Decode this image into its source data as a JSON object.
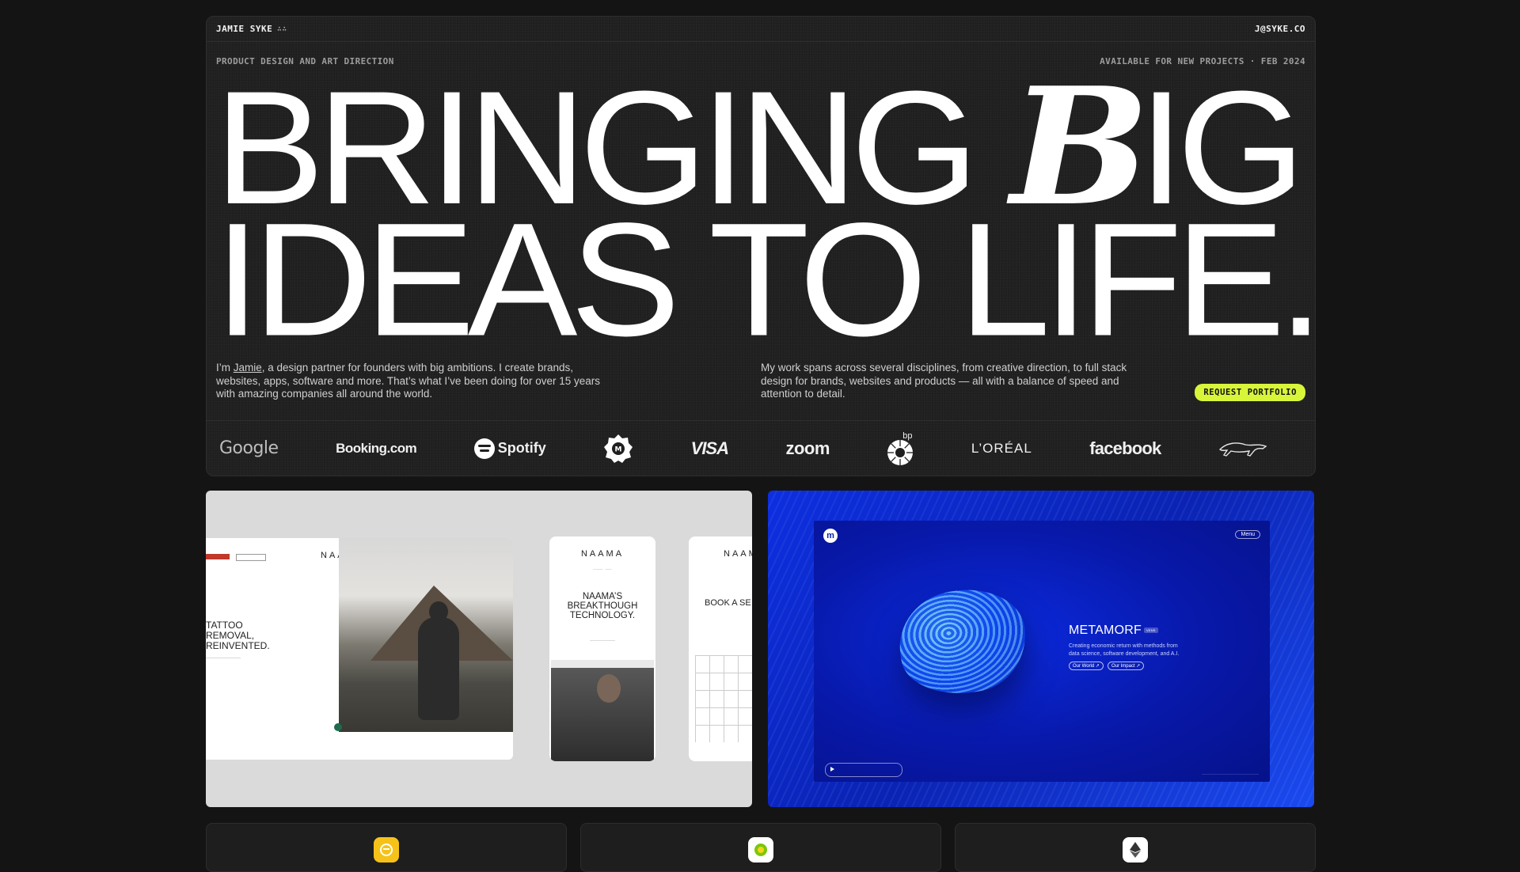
{
  "header": {
    "brand": "JAMIE SYKE",
    "brand_mark": "∴∴",
    "email": "J@SYKE.CO"
  },
  "hero": {
    "tagline_left": "PRODUCT DESIGN AND ART DIRECTION",
    "tagline_right": "AVAILABLE FOR NEW PROJECTS · FEB 2024",
    "headline_line1_a": "BRINGING ",
    "headline_line1_b": "B",
    "headline_line1_c": "IG",
    "headline_line2": "IDEAS TO LIFE.",
    "intro_prefix": "I’m ",
    "intro_name": "Jamie",
    "intro_rest": ", a design partner for founders with big ambitions. I create brands, websites, apps, software and more. That’s what I’ve been doing for over 15 years with amazing companies all around the world.",
    "intro_right": "My work spans across several disciplines, from creative direction, to full stack design for brands, websites and products — all with a balance of speed and attention to detail.",
    "cta_label": "REQUEST PORTFOLIO"
  },
  "clients": [
    {
      "name": "Google",
      "icon": "google-logo"
    },
    {
      "name": "Booking.com",
      "icon": "booking-logo"
    },
    {
      "name": "Spotify",
      "icon": "spotify-logo"
    },
    {
      "name": "M",
      "icon": "badge-logo"
    },
    {
      "name": "VISA",
      "icon": "visa-logo"
    },
    {
      "name": "zoom",
      "icon": "zoom-logo"
    },
    {
      "name": "bp",
      "icon": "bp-logo"
    },
    {
      "name": "L’ORÉAL",
      "icon": "loreal-logo"
    },
    {
      "name": "facebook",
      "icon": "facebook-logo"
    },
    {
      "name": "Jaguar",
      "icon": "jaguar-logo"
    }
  ],
  "projects": {
    "naama": {
      "brand": "NAAMA",
      "desktop_title": "TATTOO REMOVAL, REINVENTED.",
      "mobile_title": "NAAMA’S BREAKTHOUGH TECHNOLOGY.",
      "booking_title": "BOOK A SE"
    },
    "metamorf": {
      "logo": "m",
      "menu": "Menu",
      "title": "METAMORF",
      "tag": "VENS",
      "desc": "Creating economic return with methods from data science, software development, and A.I.",
      "btn1": "Our World ↗",
      "btn2": "Our Impact ↗"
    }
  },
  "colors": {
    "accent": "#d8f53a",
    "background": "#141414",
    "panel": "#1f1f1f",
    "metamorf_blue": "#0a2bd6"
  }
}
